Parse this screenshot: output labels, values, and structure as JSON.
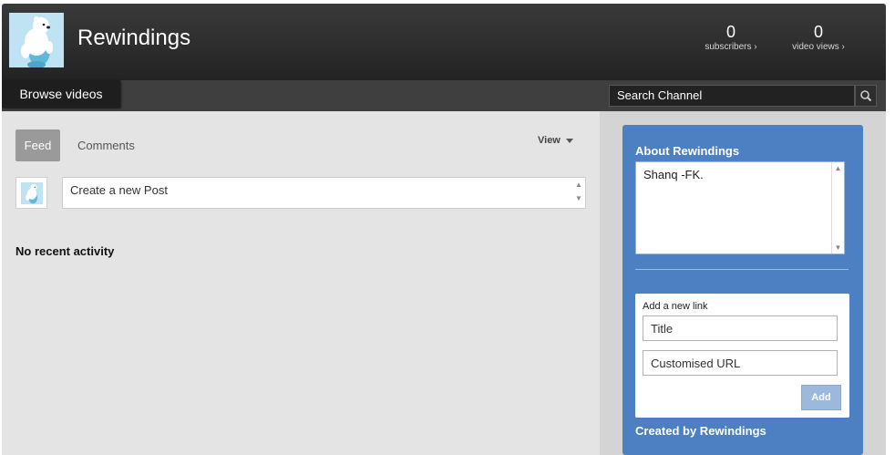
{
  "colors": {
    "header_bg": "#2b2b2b",
    "panel_blue": "#4c80c2",
    "feed_tab_bg": "#9a9a9a",
    "add_button": "#9bb9dd"
  },
  "channel": {
    "title": "Rewindings",
    "avatar_icon": "polar-bear-avatar-icon"
  },
  "stats": {
    "subscribers": {
      "value": "0",
      "label": "subscribers ›"
    },
    "video_views": {
      "value": "0",
      "label": "video views ›"
    }
  },
  "nav": {
    "browse_videos": "Browse videos",
    "search_placeholder": "Search Channel",
    "search_icon": "search-icon"
  },
  "feed": {
    "tabs": [
      {
        "label": "Feed",
        "active": true
      },
      {
        "label": "Comments",
        "active": false
      }
    ],
    "view_menu_label": "View",
    "post_placeholder": "Create a new Post",
    "empty_message": "No recent activity"
  },
  "about": {
    "title": "About Rewindings",
    "text": "Shanq -FK.",
    "add_link_label": "Add a new link",
    "title_placeholder": "Title",
    "url_placeholder": "Customised URL",
    "add_button": "Add",
    "created_by": "Created by Rewindings"
  }
}
